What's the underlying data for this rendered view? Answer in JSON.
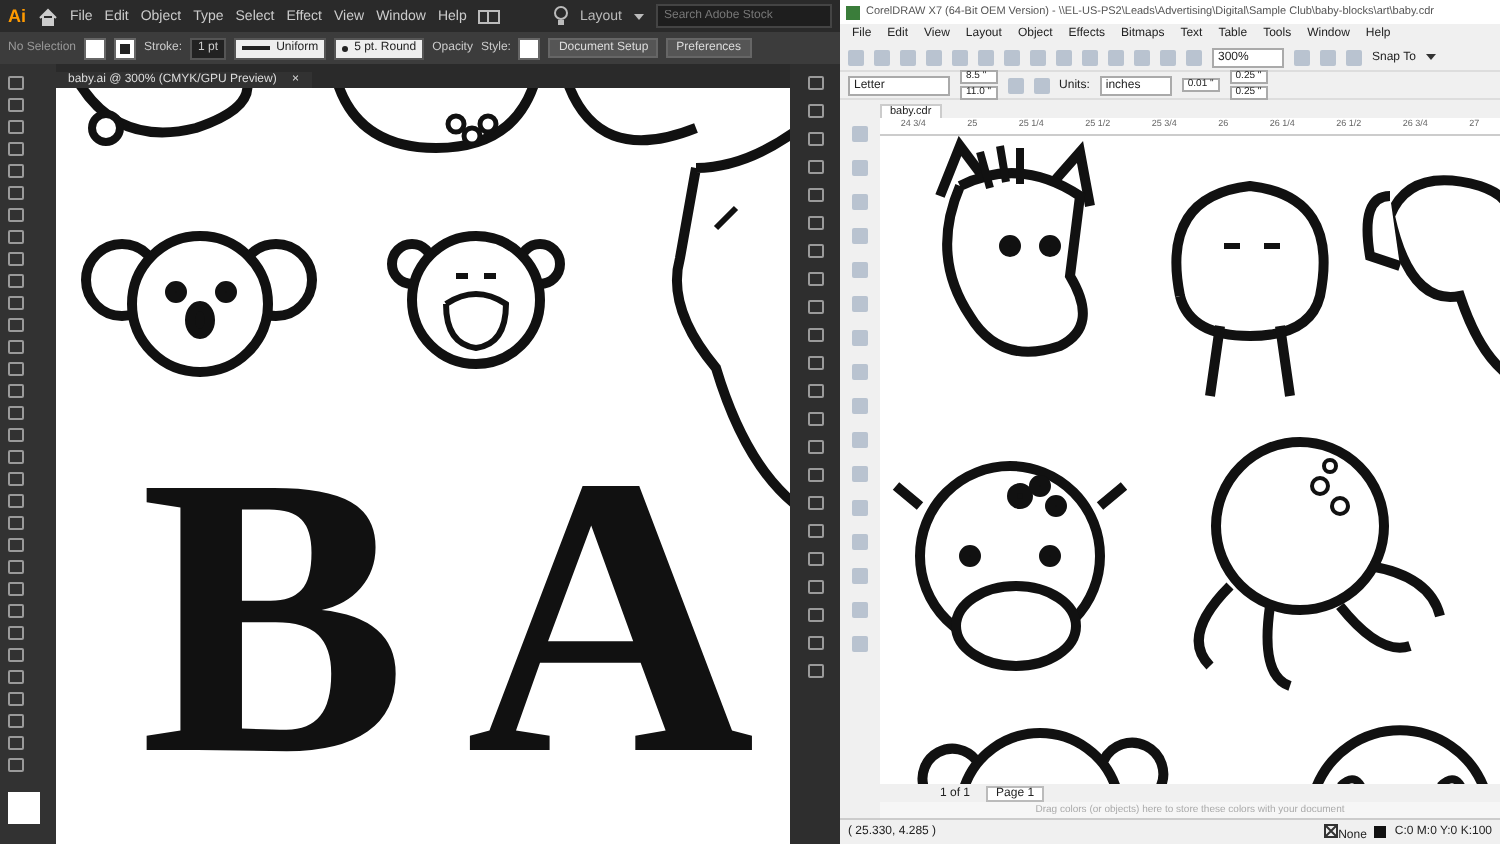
{
  "illustrator": {
    "logo": "Ai",
    "menu": [
      "File",
      "Edit",
      "Object",
      "Type",
      "Select",
      "Effect",
      "View",
      "Window",
      "Help"
    ],
    "workspace": "Layout",
    "search": {
      "placeholder": "Search Adobe Stock"
    },
    "control_bar": {
      "selection": "No Selection",
      "stroke_label": "Stroke:",
      "stroke_weight": "1 pt",
      "profile": "Uniform",
      "brush": "5 pt. Round",
      "opacity_label": "Opacity",
      "style_label": "Style:",
      "buttons": [
        "Document Setup",
        "Preferences"
      ]
    },
    "tab": {
      "title": "baby.ai @ 300% (CMYK/GPU Preview)",
      "close": "×"
    },
    "canvas": {
      "letters": [
        "B",
        "A"
      ]
    }
  },
  "coreldraw": {
    "title": "CorelDRAW X7 (64-Bit OEM Version) - \\\\EL-US-PS2\\Leads\\Advertising\\Digital\\Sample Club\\baby-blocks\\art\\baby.cdr",
    "menu": [
      "File",
      "Edit",
      "View",
      "Layout",
      "Object",
      "Effects",
      "Bitmaps",
      "Text",
      "Table",
      "Tools",
      "Window",
      "Help"
    ],
    "zoom": "300%",
    "snap": "Snap To",
    "property_bar": {
      "page_size": "Letter",
      "width": "8.5 \"",
      "height": "11.0 \"",
      "units_label": "Units:",
      "units": "inches",
      "nudge": "0.01 \"",
      "dup_x": "0.25 \"",
      "dup_y": "0.25 \""
    },
    "tab": "baby.cdr",
    "ruler": [
      "24 3/4",
      "25",
      "25 1/4",
      "25 1/2",
      "25 3/4",
      "26",
      "26 1/4",
      "26 1/2",
      "26 3/4",
      "27"
    ],
    "page_nav": {
      "count": "1 of 1",
      "page": "Page 1"
    },
    "palette_hint": "Drag colors (or objects) here to store these colors with your document",
    "status": {
      "coords": "( 25.330, 4.285 )",
      "fill": "None",
      "outline": "C:0 M:0 Y:0 K:100"
    }
  }
}
